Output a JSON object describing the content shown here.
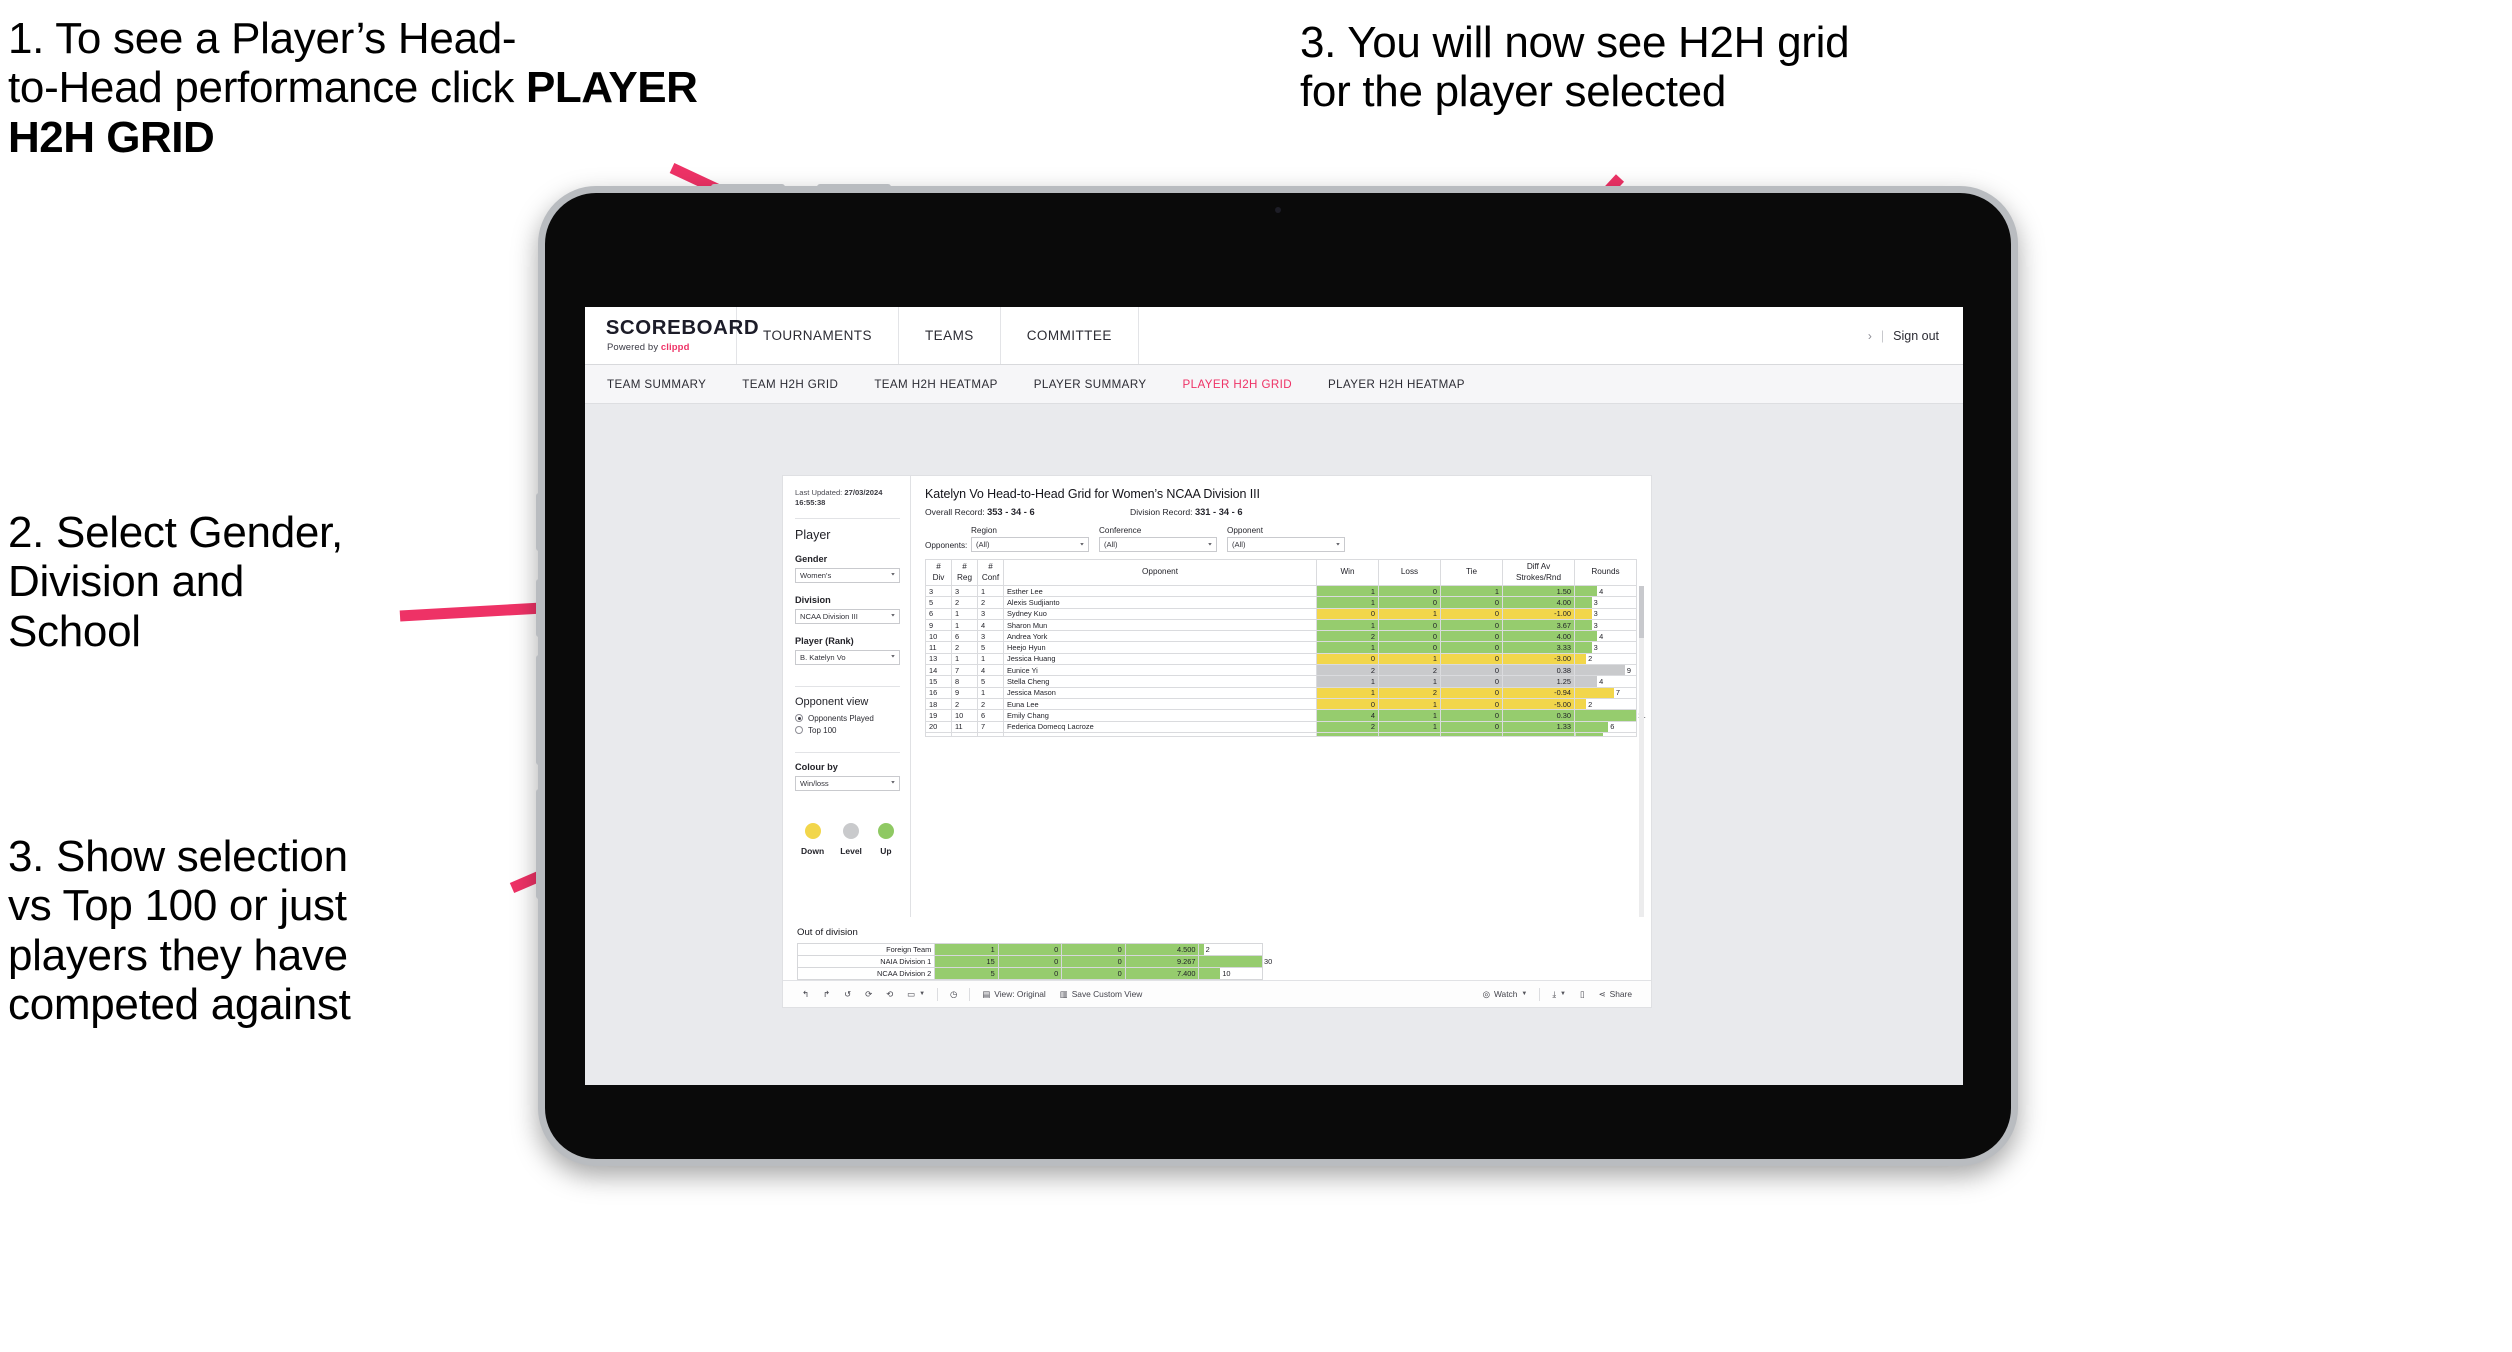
{
  "annotations": {
    "a1_line1": "1. To see a Player’s Head-\nto-Head performance click ",
    "a1_bold": "PLAYER H2H GRID",
    "a2": "2. Select Gender,\nDivision and\nSchool",
    "a3": "3. Show selection\nvs Top 100 or just\nplayers they have\ncompeted against",
    "a4": "3. You will now see H2H grid\nfor the player selected"
  },
  "colors": {
    "pink": "#ee3266",
    "green": "#96cc6e",
    "yellow": "#f2d64b",
    "grey": "#c9cacc",
    "screen_bg": "#e9eaed"
  },
  "appbar": {
    "brand_name": "SCOREBOARD",
    "brand_powered": "Powered by ",
    "brand_company": "clippd",
    "nav": [
      "TOURNAMENTS",
      "TEAMS",
      "COMMITTEE"
    ],
    "chevron_icon": "›",
    "divider": "|",
    "sign_out": "Sign out"
  },
  "subnav": {
    "items": [
      {
        "label": "TEAM SUMMARY",
        "active": false
      },
      {
        "label": "TEAM H2H GRID",
        "active": false
      },
      {
        "label": "TEAM H2H HEATMAP",
        "active": false
      },
      {
        "label": "PLAYER SUMMARY",
        "active": false
      },
      {
        "label": "PLAYER H2H GRID",
        "active": true
      },
      {
        "label": "PLAYER H2H HEATMAP",
        "active": false
      }
    ]
  },
  "left_panel": {
    "last_updated_label": "Last Updated: ",
    "last_updated_value": "27/03/2024 16:55:38",
    "player_title": "Player",
    "gender_label": "Gender",
    "gender_value": "Women's",
    "division_label": "Division",
    "division_value": "NCAA Division III",
    "player_rank_label": "Player (Rank)",
    "player_rank_value": "B. Katelyn Vo",
    "opponent_view_title": "Opponent view",
    "opponent_view_options": [
      {
        "label": "Opponents Played",
        "selected": true
      },
      {
        "label": "Top 100",
        "selected": false
      }
    ],
    "colour_by_label": "Colour by",
    "colour_by_value": "Win/loss",
    "legend": [
      {
        "label": "Down",
        "color": "#f2d64b"
      },
      {
        "label": "Level",
        "color": "#c9cacc"
      },
      {
        "label": "Up",
        "color": "#8fc963"
      }
    ]
  },
  "main": {
    "title": "Katelyn Vo Head-to-Head Grid for Women’s NCAA Division III",
    "overall_record_label": "Overall Record: ",
    "overall_record_value": "353 -  34 - 6",
    "division_record_label": "Division Record: ",
    "division_record_value": "331 -  34 - 6",
    "opponents_label": "Opponents:",
    "filters": [
      {
        "label": "Region",
        "value": "(All)"
      },
      {
        "label": "Conference",
        "value": "(All)"
      },
      {
        "label": "Opponent",
        "value": "(All)"
      }
    ]
  },
  "table": {
    "headers": [
      "#\nDiv",
      "#\nReg",
      "#\nConf",
      "Opponent",
      "Win",
      "Loss",
      "Tie",
      "Diff Av\nStrokes/Rnd",
      "Rounds"
    ],
    "rows": [
      {
        "div": "3",
        "reg": "3",
        "conf": "1",
        "opponent": "Esther Lee",
        "win": "1",
        "loss": "0",
        "tie": "1",
        "diff": "1.50",
        "rounds": "4",
        "color": "#96cc6e"
      },
      {
        "div": "5",
        "reg": "2",
        "conf": "2",
        "opponent": "Alexis Sudjianto",
        "win": "1",
        "loss": "0",
        "tie": "0",
        "diff": "4.00",
        "rounds": "3",
        "color": "#96cc6e"
      },
      {
        "div": "6",
        "reg": "1",
        "conf": "3",
        "opponent": "Sydney Kuo",
        "win": "0",
        "loss": "1",
        "tie": "0",
        "diff": "-1.00",
        "rounds": "3",
        "color": "#f2d64b"
      },
      {
        "div": "9",
        "reg": "1",
        "conf": "4",
        "opponent": "Sharon Mun",
        "win": "1",
        "loss": "0",
        "tie": "0",
        "diff": "3.67",
        "rounds": "3",
        "color": "#96cc6e"
      },
      {
        "div": "10",
        "reg": "6",
        "conf": "3",
        "opponent": "Andrea York",
        "win": "2",
        "loss": "0",
        "tie": "0",
        "diff": "4.00",
        "rounds": "4",
        "color": "#96cc6e"
      },
      {
        "div": "11",
        "reg": "2",
        "conf": "5",
        "opponent": "Heejo Hyun",
        "win": "1",
        "loss": "0",
        "tie": "0",
        "diff": "3.33",
        "rounds": "3",
        "color": "#96cc6e"
      },
      {
        "div": "13",
        "reg": "1",
        "conf": "1",
        "opponent": "Jessica Huang",
        "win": "0",
        "loss": "1",
        "tie": "0",
        "diff": "-3.00",
        "rounds": "2",
        "color": "#f2d64b"
      },
      {
        "div": "14",
        "reg": "7",
        "conf": "4",
        "opponent": "Eunice Yi",
        "win": "2",
        "loss": "2",
        "tie": "0",
        "diff": "0.38",
        "rounds": "9",
        "color": "#c9cacc"
      },
      {
        "div": "15",
        "reg": "8",
        "conf": "5",
        "opponent": "Stella Cheng",
        "win": "1",
        "loss": "1",
        "tie": "0",
        "diff": "1.25",
        "rounds": "4",
        "color": "#c9cacc"
      },
      {
        "div": "16",
        "reg": "9",
        "conf": "1",
        "opponent": "Jessica Mason",
        "win": "1",
        "loss": "2",
        "tie": "0",
        "diff": "-0.94",
        "rounds": "7",
        "color": "#f2d64b"
      },
      {
        "div": "18",
        "reg": "2",
        "conf": "2",
        "opponent": "Euna Lee",
        "win": "0",
        "loss": "1",
        "tie": "0",
        "diff": "-5.00",
        "rounds": "2",
        "color": "#f2d64b"
      },
      {
        "div": "19",
        "reg": "10",
        "conf": "6",
        "opponent": "Emily Chang",
        "win": "4",
        "loss": "1",
        "tie": "0",
        "diff": "0.30",
        "rounds": "11",
        "color": "#96cc6e"
      },
      {
        "div": "20",
        "reg": "11",
        "conf": "7",
        "opponent": "Federica Domecq Lacroze",
        "win": "2",
        "loss": "1",
        "tie": "0",
        "diff": "1.33",
        "rounds": "6",
        "color": "#96cc6e"
      }
    ],
    "max_rounds": 11
  },
  "out_of_division": {
    "title": "Out of division",
    "rows": [
      {
        "name": "Foreign Team",
        "win": "1",
        "loss": "0",
        "tie": "0",
        "diff": "4.500",
        "rounds": "2",
        "color": "#96cc6e"
      },
      {
        "name": "NAIA Division 1",
        "win": "15",
        "loss": "0",
        "tie": "0",
        "diff": "9.267",
        "rounds": "30",
        "color": "#96cc6e"
      },
      {
        "name": "NCAA Division 2",
        "win": "5",
        "loss": "0",
        "tie": "0",
        "diff": "7.400",
        "rounds": "10",
        "color": "#96cc6e"
      }
    ],
    "max_rounds": 30
  },
  "toolbar": {
    "undo_icon": "↰",
    "redo_icon": "↱",
    "revert_icon": "↺",
    "refresh_icon": "⟳",
    "pause_icon": "◷",
    "view_label": "View: Original",
    "save_label": "Save Custom View",
    "watch_label": "Watch",
    "share_label": "Share"
  }
}
